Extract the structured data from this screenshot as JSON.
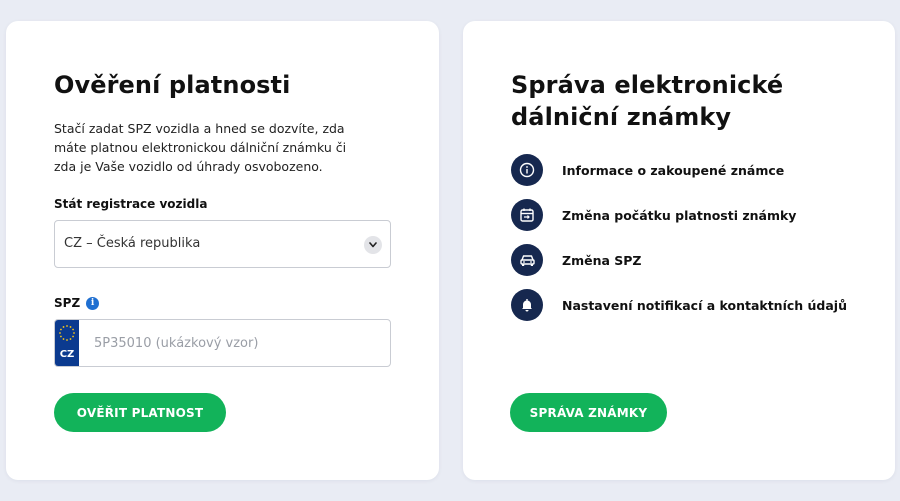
{
  "left_card": {
    "title": "Ověření platnosti",
    "description": "Stačí zadat SPZ vozidla a hned se dozvíte, zda máte platnou elektronickou dálniční známku či zda je Vaše vozidlo od úhrady osvobozeno.",
    "state_label": "Stát registrace vozidla",
    "state_value": "CZ – Česká republika",
    "spz_label": "SPZ",
    "info_icon_glyph": "i",
    "country_code": "CZ",
    "spz_placeholder": "5P35010 (ukázkový vzor)",
    "spz_value": "",
    "verify_button": "OVĚŘIT PLATNOST"
  },
  "right_card": {
    "title": "Správa elektronické dálniční známky",
    "menu": [
      {
        "label": "Informace o zakoupené známce",
        "icon": "info-icon"
      },
      {
        "label": "Změna počátku platnosti známky",
        "icon": "calendar-icon"
      },
      {
        "label": "Změna SPZ",
        "icon": "car-icon"
      },
      {
        "label": "Nastavení notifikací a kontaktních údajů",
        "icon": "bell-icon"
      }
    ],
    "manage_button": "SPRÁVA ZNÁMKY"
  },
  "colors": {
    "background": "#e9ecf4",
    "accent_green": "#12b35a",
    "icon_navy": "#16284f",
    "info_blue": "#1f6fd1",
    "eu_blue": "#0b3a8f"
  }
}
